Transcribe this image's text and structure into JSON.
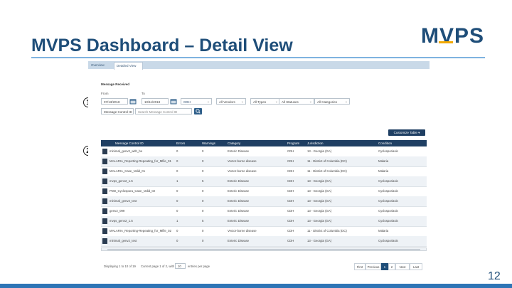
{
  "slide": {
    "title": "MVPS Dashboard – Detail View",
    "logo_text": "MVPS",
    "page_number": "12",
    "markers": [
      "1",
      "2"
    ]
  },
  "colors": {
    "title": "#1f4e79",
    "header": "#1f3f63",
    "accent": "#2e75b6"
  },
  "app": {
    "tabs": [
      {
        "label": "Overview"
      },
      {
        "label": "Detailed View"
      }
    ],
    "filters": {
      "section_label": "Message Received",
      "from_label": "From",
      "to_label": "To",
      "from_value": "07/13/2018",
      "to_value": "10/11/2018",
      "dropdowns": [
        "CDH",
        "All Vendors",
        "All Types",
        "All Statuses",
        "All Categories"
      ],
      "id_select": "Message Control ID",
      "search_placeholder": "Search Message Control ID"
    },
    "customize_label": "Customize Table ▾",
    "columns": [
      "Message Control ID",
      "Errors",
      "Warnings",
      "Category",
      "Program",
      "Jurisdiction",
      "Condition"
    ],
    "rows": [
      [
        "minimal_genv2_with_bo",
        "0",
        "0",
        "Enteric Disease",
        "CDH",
        "13 - Georgia (GA)",
        "Cyclosporiasis"
      ],
      [
        "MALARIA_Reporting-Repeating_for_Mfile_01",
        "0",
        "0",
        "Vector-borne disease",
        "CDH",
        "11 - District of Columbia (DC)",
        "Malaria"
      ],
      [
        "MALARIA_Case_Valid_01",
        "0",
        "0",
        "Vector-borne disease",
        "CDH",
        "11 - District of Columbia (DC)",
        "Malaria"
      ],
      [
        "mvps_genv2_1.5",
        "1",
        "5",
        "Enteric Disease",
        "CDH",
        "13 - Georgia (GA)",
        "Cyclosporiasis"
      ],
      [
        "PDD_Cyclospora_Case_Valid_02",
        "0",
        "0",
        "Enteric Disease",
        "CDH",
        "13 - Georgia (GA)",
        "Cyclosporiasis"
      ],
      [
        "minimal_genv2_test",
        "0",
        "0",
        "Enteric Disease",
        "CDH",
        "13 - Georgia (GA)",
        "Cyclosporiasis"
      ],
      [
        "genv2_099",
        "0",
        "0",
        "Enteric Disease",
        "CDH",
        "13 - Georgia (GA)",
        "Cyclosporiasis"
      ],
      [
        "mvps_genv2_1.5",
        "1",
        "5",
        "Enteric Disease",
        "CDH",
        "13 - Georgia (GA)",
        "Cyclosporiasis"
      ],
      [
        "MALARIA_Reporting-Repeating_for_Mfile_02",
        "0",
        "0",
        "Vector-borne disease",
        "CDH",
        "11 - District of Columbia (DC)",
        "Malaria"
      ],
      [
        "minimal_genv2_test",
        "0",
        "0",
        "Enteric Disease",
        "CDH",
        "13 - Georgia (GA)",
        "Cyclosporiasis"
      ]
    ],
    "footer": {
      "showing": "Displaying 1 to 10 of 19",
      "page_info": "Current page 1 of 2, with",
      "per_page": "10",
      "entries_suffix": "entries per page"
    },
    "pagination": [
      "First",
      "Previous",
      "1",
      "2",
      "Next",
      "Last"
    ]
  }
}
